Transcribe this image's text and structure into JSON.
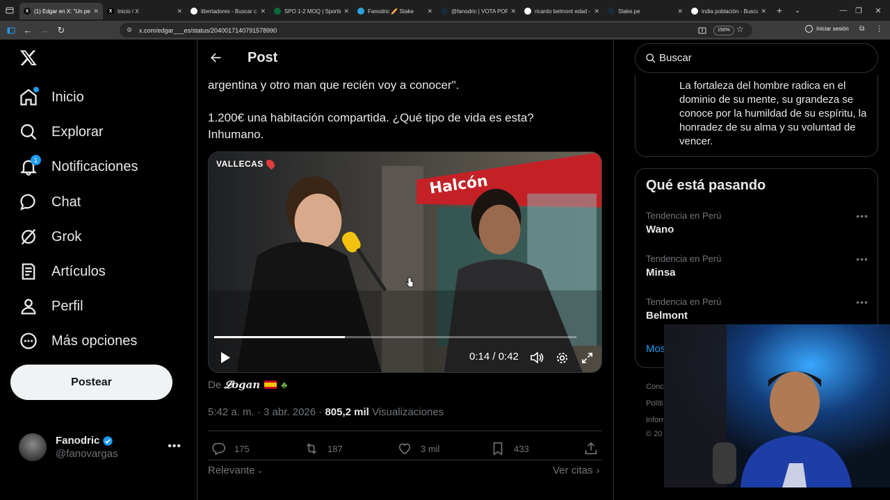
{
  "browser": {
    "tabs": [
      {
        "title": "(1) Edgar en X: \"Un pe",
        "active": true,
        "favicon": "x-favicon"
      },
      {
        "title": "Inicio / X",
        "active": false,
        "favicon": "x-favicon"
      },
      {
        "title": "libertadores - Buscar c",
        "active": false,
        "favicon": "google-favicon"
      },
      {
        "title": "SPO 1-2 MOQ | Sportin",
        "active": false,
        "favicon": "sporting-favicon"
      },
      {
        "title": "Fanodric 🥖 Stake",
        "active": false,
        "favicon": "telegram-favicon"
      },
      {
        "title": "@fanodric | VOTA POR",
        "active": false,
        "favicon": "stake-favicon"
      },
      {
        "title": "ricardo belmont edad -",
        "active": false,
        "favicon": "google-favicon"
      },
      {
        "title": "Stake.pe",
        "active": false,
        "favicon": "stake-favicon"
      },
      {
        "title": "india población - Busca",
        "active": false,
        "favicon": "google-favicon"
      }
    ],
    "url": "x.com/edgar___es/status/2040017140791578990",
    "zoom": "150%",
    "signin_label": "Iniciar sesión"
  },
  "sidebar": {
    "items": [
      {
        "label": "Inicio",
        "icon": "home-icon"
      },
      {
        "label": "Explorar",
        "icon": "search-icon"
      },
      {
        "label": "Notificaciones",
        "icon": "bell-icon",
        "badge": "1"
      },
      {
        "label": "Chat",
        "icon": "chat-icon"
      },
      {
        "label": "Grok",
        "icon": "grok-icon"
      },
      {
        "label": "Artículos",
        "icon": "articles-icon"
      },
      {
        "label": "Perfil",
        "icon": "user-icon"
      },
      {
        "label": "Más opciones",
        "icon": "more-circle-icon"
      }
    ],
    "post_button": "Postear",
    "account": {
      "name": "Fanodric",
      "handle": "@fanovargas"
    }
  },
  "header": {
    "title": "Post"
  },
  "tweet": {
    "text_line1": "argentina y otro man que recién voy a conocer\".",
    "text_line2": "1.200€ una habitación compartida. ¿Qué tipo de vida es esta?",
    "text_line3": "Inhumano.",
    "video": {
      "location_tag": "VALLECAS",
      "time": "0:14 / 0:42",
      "progress": 0.36
    },
    "credit_prefix": "De",
    "credit_name": "𝓛𝒐𝒈𝒂𝒏",
    "timestamp": "5:42 a. m. · 3 abr. 2026 · ",
    "views_count": "805,2 mil",
    "views_label": " Visualizaciones",
    "actions": {
      "replies": "175",
      "reposts": "187",
      "likes": "3 mil",
      "bookmarks": "433"
    },
    "sort_label": "Relevante",
    "quotes_label": "Ver citas"
  },
  "right": {
    "search_placeholder": "Buscar",
    "bio_text": "La fortaleza del hombre radica en el dominio de su mente, su grandeza se conoce por la humildad de su espíritu, la honradez de su alma y su voluntad de vencer.",
    "trends_title": "Qué está pasando",
    "trends": [
      {
        "context": "Tendencia en Perú",
        "name": "Wano"
      },
      {
        "context": "Tendencia en Perú",
        "name": "Minsa"
      },
      {
        "context": "Tendencia en Perú",
        "name": "Belmont"
      }
    ],
    "show_more": "Mos",
    "footer": [
      "Conc",
      "Políti",
      "Inforn",
      "© 20"
    ]
  },
  "colors": {
    "accent": "#1d9bf0",
    "background": "#000000",
    "text": "#e7e9ea",
    "muted": "#71767b"
  }
}
